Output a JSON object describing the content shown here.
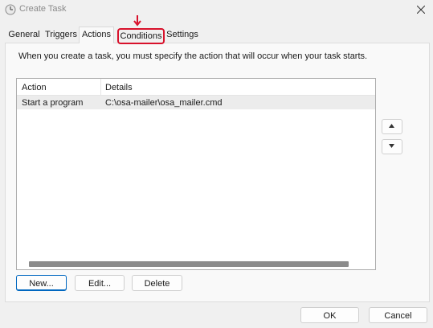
{
  "window": {
    "title": "Create Task"
  },
  "tabs": [
    {
      "label": "General"
    },
    {
      "label": "Triggers"
    },
    {
      "label": "Actions"
    },
    {
      "label": "Conditions"
    },
    {
      "label": "Settings"
    }
  ],
  "active_tab": "Actions",
  "highlighted_tab": "Conditions",
  "actions_page": {
    "instruction": "When you create a task, you must specify the action that will occur when your task starts.",
    "columns": [
      "Action",
      "Details"
    ],
    "rows": [
      {
        "action": "Start a program",
        "details": "C:\\osa-mailer\\osa_mailer.cmd"
      }
    ],
    "buttons": {
      "new": "New...",
      "edit": "Edit...",
      "delete": "Delete"
    },
    "move_icons": [
      "move-up-icon",
      "move-down-icon"
    ]
  },
  "footer": {
    "ok": "OK",
    "cancel": "Cancel"
  },
  "colors": {
    "highlight": "#d8112b",
    "accent": "#0067c0"
  }
}
